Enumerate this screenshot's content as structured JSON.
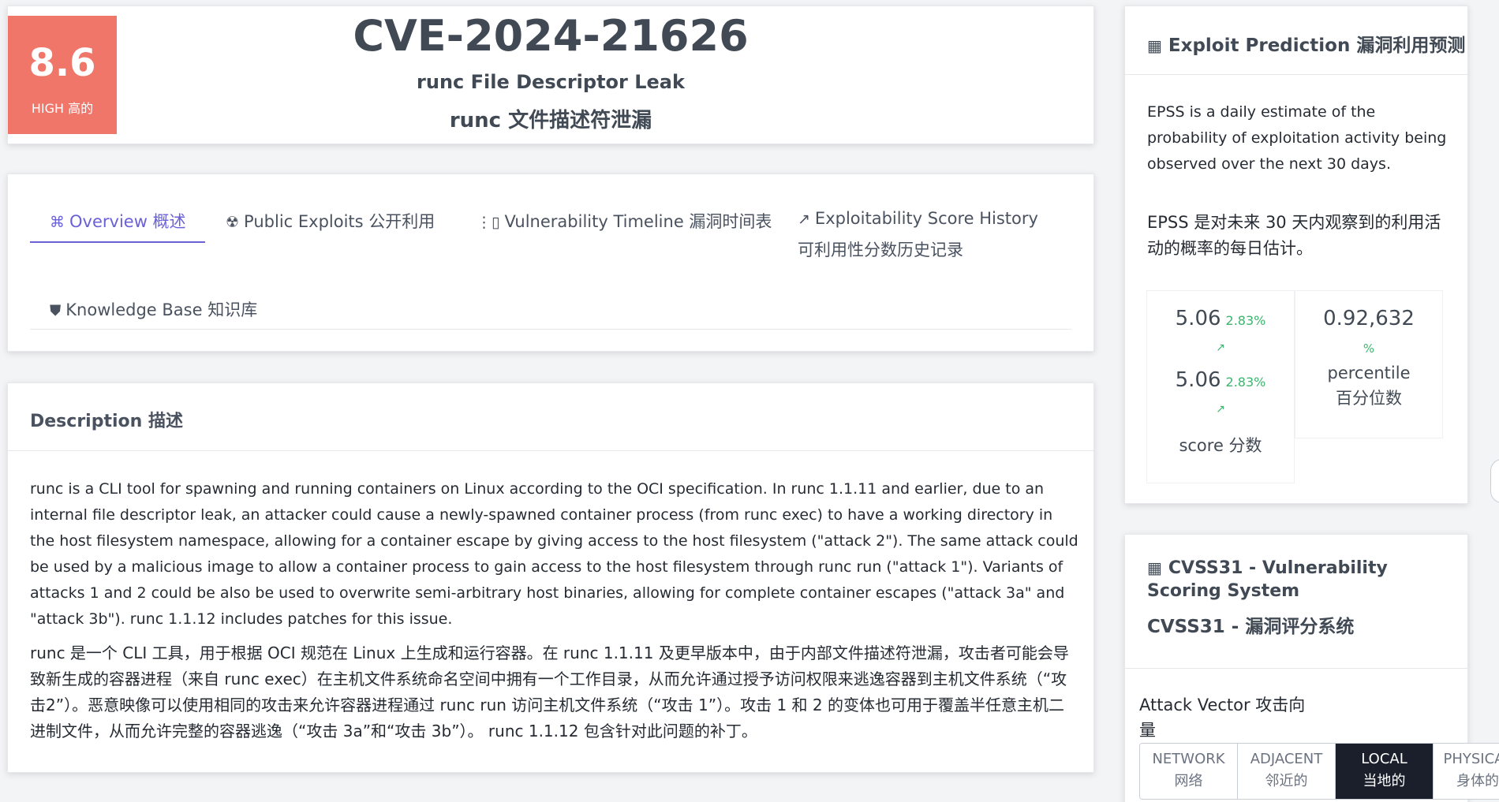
{
  "header": {
    "score": "8.6",
    "severity": "HIGH 高的",
    "cve_id": "CVE-2024-21626",
    "title": "runc File Descriptor Leak",
    "title_zh": "runc 文件描述符泄漏",
    "badge_color": "#f0766a"
  },
  "tabs": [
    {
      "label": "Overview  概述",
      "icon": "command-icon",
      "active": true
    },
    {
      "label": "Public Exploits  公开利用",
      "icon": "radiation-icon"
    },
    {
      "label": "Vulnerability Timeline  漏洞时间表",
      "icon": "timeline-icon"
    },
    {
      "label": "Exploitability Score History",
      "label_zh": "可利用性分数历史记录",
      "icon": "trend-up-icon"
    },
    {
      "label": "Knowledge Base  知识库",
      "icon": "book-icon"
    }
  ],
  "accent_color": "#6a61d9",
  "description": {
    "heading": "Description 描述",
    "text_en": "runc is a CLI tool for spawning and running containers on Linux according to the OCI specification. In runc 1.1.11 and earlier, due to an internal file descriptor leak, an attacker could cause a newly-spawned container process (from runc exec) to have a working directory in the host filesystem namespace, allowing for a container escape by giving access to the host filesystem (\"attack 2\"). The same attack could be used by a malicious image to allow a container process to gain access to the host filesystem through runc run (\"attack 1\"). Variants of attacks 1 and 2 could be also be used to overwrite semi-arbitrary host binaries, allowing for complete container escapes (\"attack 3a\" and \"attack 3b\"). runc 1.1.12 includes patches for this issue.",
    "text_zh": "runc 是一个 CLI 工具，用于根据 OCI 规范在 Linux 上生成和运行容器。在 runc 1.1.11 及更早版本中，由于内部文件描述符泄漏，攻击者可能会导致新生成的容器进程（来自 runc exec）在主机文件系统命名空间中拥有一个工作目录，从而允许通过授予访问权限来逃逸容器到主机文件系统（“攻击2”）。恶意映像可以使用相同的攻击来允许容器进程通过 runc run 访问主机文件系统（“攻击 1”）。攻击 1 和 2 的变体也可用于覆盖半任意主机二进制文件，从而允许完整的容器逃逸（“攻击 3a”和“攻击 3b”）。 runc 1.1.12 包含针对此问题的补丁。"
  },
  "epss": {
    "title": "Exploit Prediction 漏洞利用预测",
    "desc_en": "EPSS is a daily estimate of the probability of exploitation activity being observed over the next 30 days.",
    "desc_zh": "EPSS 是对未来 30 天内观察到的利用活动的概率的每日估计。",
    "score_value": "5.06",
    "score_change": "2.83%",
    "score_label": "score 分数",
    "percentile_value": "0.92,632",
    "percentile_symbol": "%",
    "percentile_label": "percentile 百分位数",
    "change_color": "#3cb46e"
  },
  "cvss": {
    "title": "CVSS31 - Vulnerability Scoring System",
    "title_zh": "CVSS31 - 漏洞评分系统",
    "attack_vector_label": "Attack Vector 攻击向量",
    "options": [
      {
        "en": "NETWORK",
        "zh": "网络",
        "active": false
      },
      {
        "en": "ADJACENT",
        "zh": "邻近的",
        "active": false
      },
      {
        "en": "LOCAL",
        "zh": "当地的",
        "active": true
      },
      {
        "en": "PHYSICAL",
        "zh": "身体的",
        "active": false
      }
    ]
  }
}
